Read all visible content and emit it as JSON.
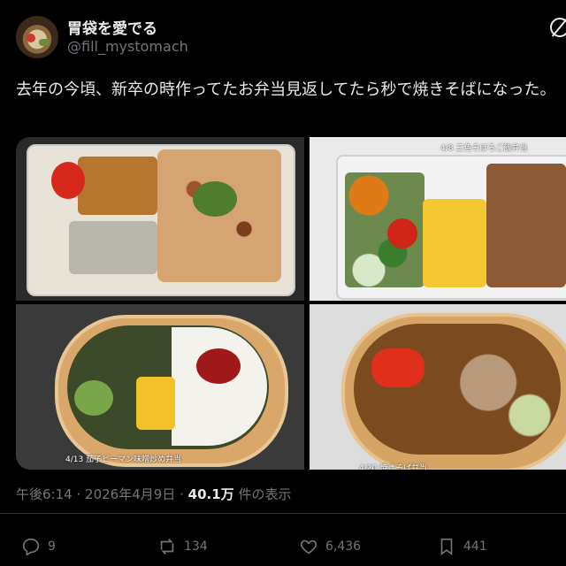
{
  "author": {
    "display_name": "胃袋を愛でる",
    "handle": "@fill_mystomach"
  },
  "tweet": {
    "text": "去年の今頃、新卒の時作ってたお弁当見返してたら秒で焼きそばになった。"
  },
  "photos": [
    {
      "caption": ""
    },
    {
      "caption": "4/8 三色そぼろご飯弁当"
    },
    {
      "caption": "4/13 茄子ピーマン味噌炒め弁当"
    },
    {
      "caption": "4/20 焼きそば弁当"
    }
  ],
  "meta": {
    "time": "午後6:14",
    "separator": "·",
    "date": "2026年4月9日",
    "views_count": "40.1万",
    "views_label": "件の表示"
  },
  "actions": {
    "replies": "9",
    "reposts": "134",
    "likes": "6,436",
    "bookmarks": "441"
  },
  "colors": {
    "background": "#000000",
    "text": "#e7e9ea",
    "muted": "#71767b"
  }
}
